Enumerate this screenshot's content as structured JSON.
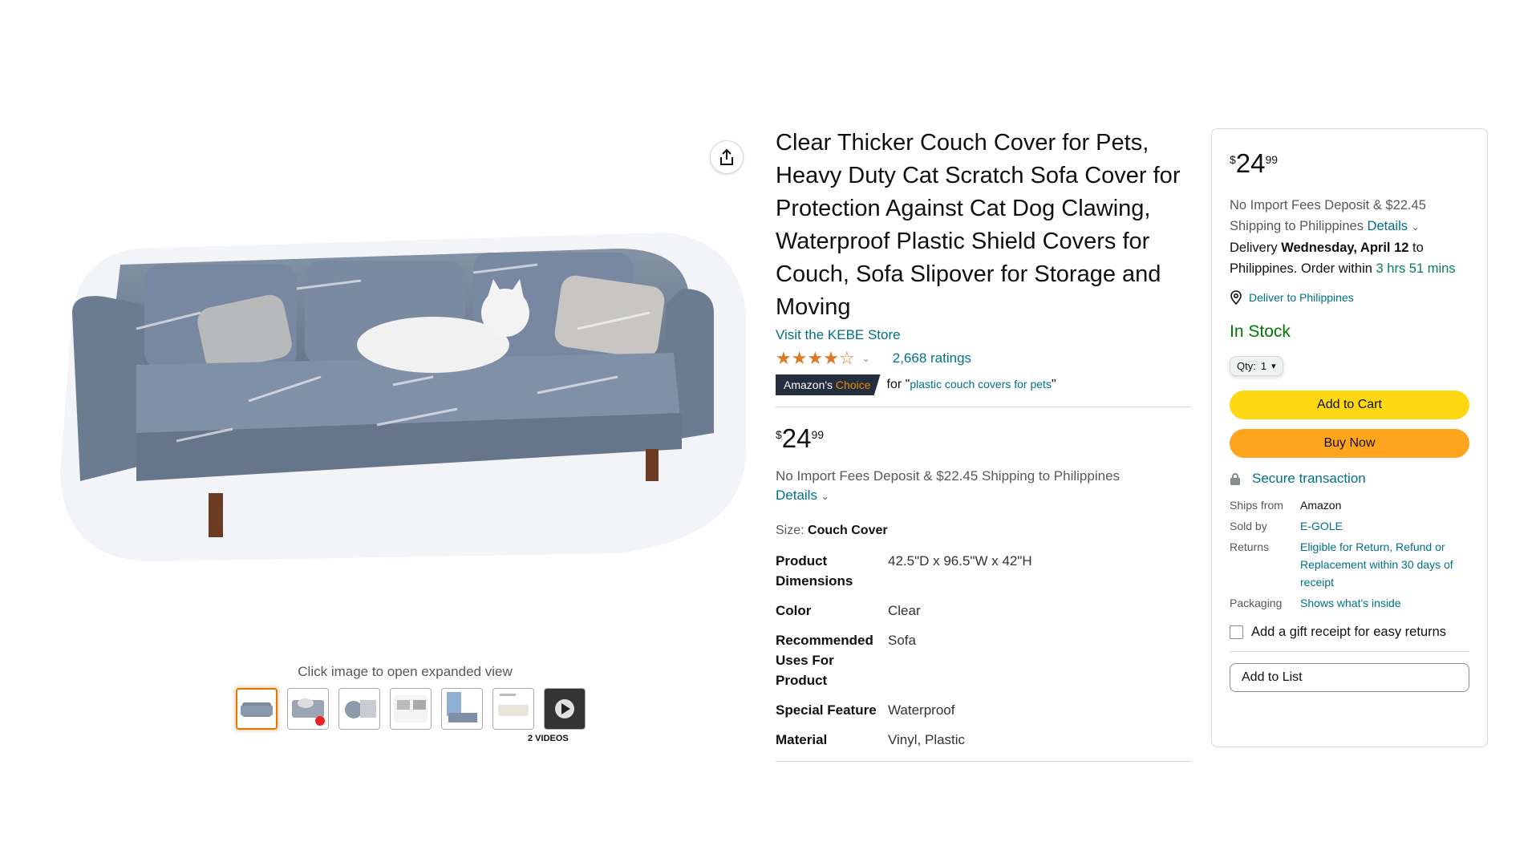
{
  "product": {
    "title": "Clear Thicker Couch Cover for Pets, Heavy Duty Cat Scratch Sofa Cover for Protection Against Cat Dog Clawing, Waterproof Plastic Shield Covers for Couch, Sofa Slipover for Storage and Moving",
    "store_link": "Visit the KEBE Store",
    "rating_value": 4.0,
    "rating_count": "2,668 ratings",
    "choice_badge_prefix": "Amazon's",
    "choice_badge_suffix": "Choice",
    "choice_for": "for \"",
    "choice_query": "plastic couch covers for pets",
    "choice_close": "\"",
    "price": {
      "symbol": "$",
      "whole": "24",
      "fraction": "99"
    },
    "import_fees": "No Import Fees Deposit & $22.45 Shipping to Philippines",
    "details_link": "Details",
    "size_label": "Size:",
    "size_value": "Couch Cover",
    "specs": [
      {
        "key": "Product Dimensions",
        "value": "42.5\"D x 96.5\"W x 42\"H"
      },
      {
        "key": "Color",
        "value": "Clear"
      },
      {
        "key": "Recommended Uses For Product",
        "value": "Sofa"
      },
      {
        "key": "Special Feature",
        "value": "Waterproof"
      },
      {
        "key": "Material",
        "value": "Vinyl, Plastic"
      }
    ]
  },
  "gallery": {
    "expand_hint": "Click image to open expanded view",
    "videos_label": "2 VIDEOS",
    "thumbnail_count": 7,
    "selected_index": 0
  },
  "buybox": {
    "price": {
      "symbol": "$",
      "whole": "24",
      "fraction": "99"
    },
    "import_line": "No Import Fees Deposit & $22.45 Shipping to Philippines",
    "details_link": "Details",
    "delivery_prefix": "Delivery",
    "delivery_date": "Wednesday, April 12",
    "delivery_mid": "to Philippines. Order within",
    "delivery_countdown": "3 hrs 51 mins",
    "deliver_to": "Deliver to Philippines",
    "stock": "In Stock",
    "qty_label": "Qty:",
    "qty_value": "1",
    "add_to_cart": "Add to Cart",
    "buy_now": "Buy Now",
    "secure": "Secure transaction",
    "info": [
      {
        "key": "Ships from",
        "value": "Amazon",
        "link": false
      },
      {
        "key": "Sold by",
        "value": "E-GOLE",
        "link": true
      },
      {
        "key": "Returns",
        "value": "Eligible for Return, Refund or Replacement within 30 days of receipt",
        "link": true
      },
      {
        "key": "Packaging",
        "value": "Shows what's inside",
        "link": true
      }
    ],
    "gift_receipt": "Add a gift receipt for easy returns",
    "add_to_list": "Add to List"
  },
  "colors": {
    "link": "#007185",
    "add_to_cart": "#ffd814",
    "buy_now": "#ffa41c",
    "in_stock": "#007600",
    "badge_bg": "#232f3e",
    "star": "#de7921"
  }
}
